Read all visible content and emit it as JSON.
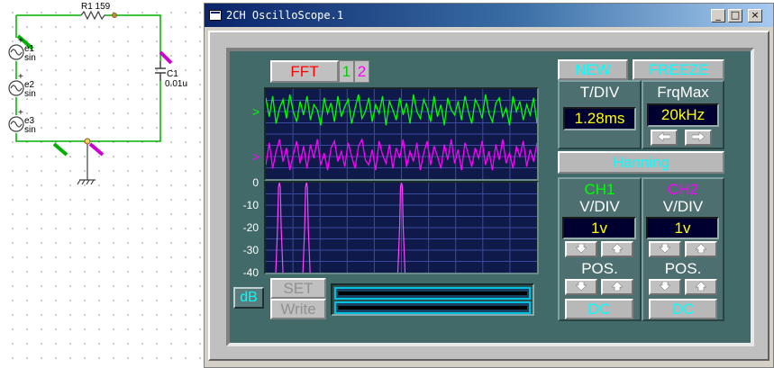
{
  "schematic": {
    "resistor_label": "R1 159",
    "capacitor_label": "C1",
    "capacitor_value": "0.01u",
    "sources": [
      {
        "name": "e1",
        "type": "sin",
        "polarity": "+"
      },
      {
        "name": "e2",
        "type": "sin",
        "polarity": "+"
      },
      {
        "name": "e3",
        "type": "sin",
        "polarity": "+"
      }
    ]
  },
  "window": {
    "title": "2CH OscilloScope.1",
    "controls": {
      "minimize": "_",
      "maximize": "□",
      "close": "×"
    }
  },
  "scope": {
    "fft_label": "FFT",
    "ch1_toggle": "1",
    "ch2_toggle": "2",
    "new_label": "NEW",
    "freeze_label": "FREEZE",
    "tdiv_label": "T/DIV",
    "tdiv_value": "1.28ms",
    "frqmax_label": "FrqMax",
    "frqmax_value": "20kHz",
    "window_function": "Hanning",
    "db_label": "dB",
    "set_label": "SET",
    "write_label": "Write",
    "ch1": {
      "label": "CH1",
      "vdiv_label": "V/DIV",
      "vdiv_value": "1v",
      "pos_label": "POS.",
      "coupling": "DC"
    },
    "ch2": {
      "label": "CH2",
      "vdiv_label": "V/DIV",
      "vdiv_value": "1v",
      "pos_label": "POS.",
      "coupling": "DC"
    },
    "trace_marker": ">",
    "colors": {
      "ch1": "#00ff00",
      "ch2": "#ff00ff",
      "accent_cyan": "#00ffff",
      "lcd_text": "#ffff00",
      "panel": "#426a69"
    }
  },
  "chart_data": [
    {
      "type": "line",
      "series": [
        {
          "color": "#00ff00",
          "values": [
            0.9,
            0.35,
            0.95,
            0.15,
            0.6,
            0.85,
            0.3,
            1.0,
            0.5,
            0.2,
            0.8,
            0.4,
            0.95,
            0.25,
            0.7,
            0.55,
            0.1,
            0.9,
            0.45,
            0.75,
            0.2,
            0.95,
            0.35,
            0.65,
            0.85,
            0.15,
            0.6,
            1.0,
            0.3,
            0.5,
            0.9,
            0.2,
            0.7,
            0.45,
            0.95,
            0.1,
            0.8,
            0.55,
            0.25,
            0.9,
            0.4,
            0.75,
            0.15,
            1.0,
            0.5,
            0.3,
            0.85,
            0.6,
            0.2,
            0.95,
            0.35,
            0.7,
            0.1,
            0.9,
            0.55,
            0.4,
            0.8,
            0.25,
            0.95,
            0.5,
            0.15,
            0.85,
            0.65,
            0.3,
            1.0,
            0.45,
            0.2,
            0.75,
            0.9,
            0.35,
            0.6,
            0.1,
            0.95,
            0.5,
            0.8,
            0.25,
            0.7,
            0.4,
            0.9,
            0.15
          ]
        },
        {
          "color": "#ff00ff",
          "values": [
            0.2,
            0.85,
            0.1,
            0.6,
            0.95,
            0.3,
            0.7,
            0.05,
            0.5,
            0.9,
            0.25,
            0.75,
            0.1,
            0.8,
            0.4,
            0.95,
            0.2,
            0.55,
            0.05,
            0.7,
            0.9,
            0.3,
            0.6,
            0.15,
            0.85,
            0.45,
            0.1,
            0.75,
            0.95,
            0.35,
            0.2,
            0.65,
            0.05,
            0.9,
            0.5,
            0.25,
            0.8,
            0.1,
            0.7,
            0.4,
            0.95,
            0.15,
            0.6,
            0.3,
            0.85,
            0.05,
            0.55,
            0.9,
            0.2,
            0.75,
            0.45,
            0.1,
            0.8,
            0.35,
            0.95,
            0.25,
            0.65,
            0.05,
            0.85,
            0.5,
            0.15,
            0.7,
            0.4,
            0.9,
            0.2,
            0.6,
            0.05,
            0.8,
            0.35,
            0.95,
            0.25,
            0.55,
            0.1,
            0.75,
            0.45,
            0.9,
            0.15,
            0.65,
            0.3,
            0.85
          ]
        }
      ]
    },
    {
      "type": "line",
      "y_ticks": [
        "0",
        "-10",
        "-20",
        "-30",
        "-40"
      ],
      "ylim": [
        -40,
        0
      ],
      "grid": true,
      "series": [
        {
          "color": "#ff40ff",
          "peaks": [
            0.05,
            0.15,
            0.5
          ]
        }
      ]
    }
  ]
}
